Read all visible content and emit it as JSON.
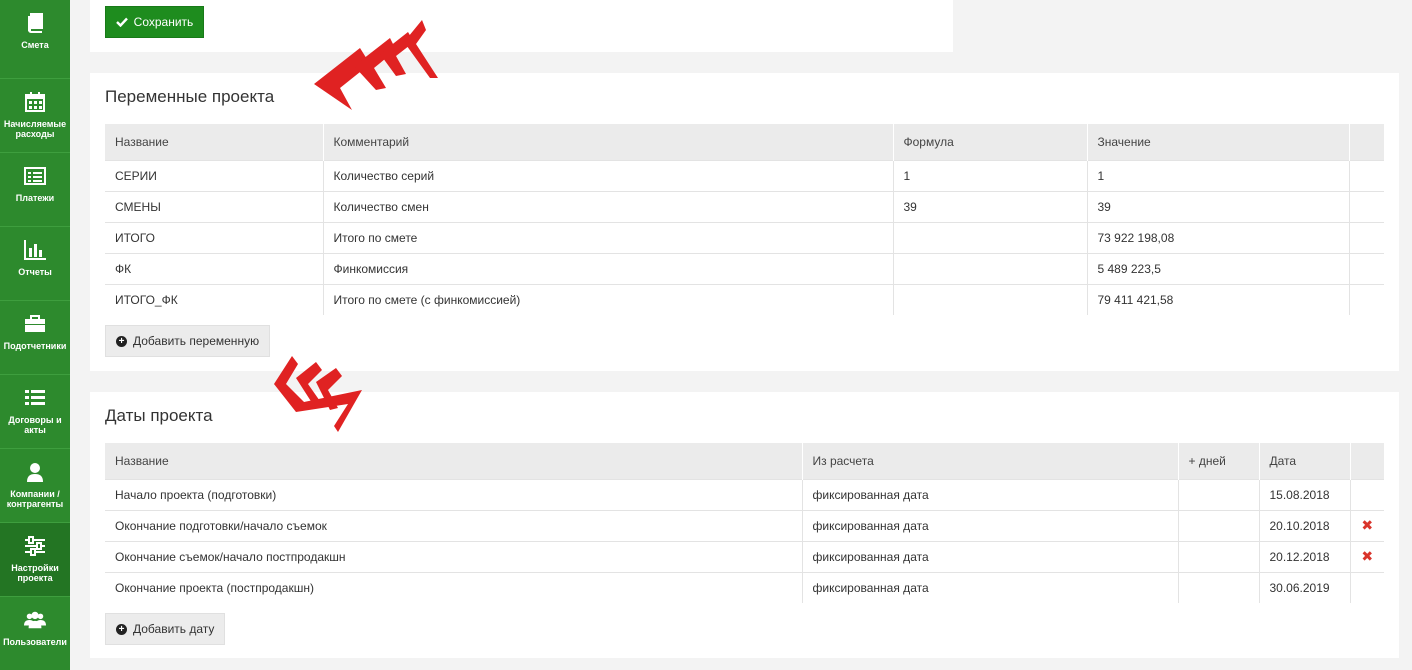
{
  "sidebar": {
    "items": [
      {
        "label": "Смета",
        "icon": "book-icon"
      },
      {
        "label": "Начисляемые расходы",
        "icon": "calendar-icon"
      },
      {
        "label": "Платежи",
        "icon": "list-card-icon"
      },
      {
        "label": "Отчеты",
        "icon": "bar-chart-icon"
      },
      {
        "label": "Подотчетники",
        "icon": "briefcase-icon"
      },
      {
        "label": "Договоры и акты",
        "icon": "list-icon"
      },
      {
        "label": "Компании / контрагенты",
        "icon": "user-icon"
      },
      {
        "label": "Настройки проекта",
        "icon": "sliders-icon"
      },
      {
        "label": "Пользователи",
        "icon": "users-icon"
      }
    ]
  },
  "save_button": {
    "label": "Сохранить"
  },
  "variables": {
    "title": "Переменные проекта",
    "columns": [
      "Название",
      "Комментарий",
      "Формула",
      "Значение"
    ],
    "rows": [
      {
        "name": "СЕРИИ",
        "comment": "Количество серий",
        "formula": "1",
        "value": "1"
      },
      {
        "name": "СМЕНЫ",
        "comment": "Количество смен",
        "formula": "39",
        "value": "39"
      },
      {
        "name": "ИТОГО",
        "comment": "Итого по смете",
        "formula": "",
        "value": "73 922 198,08"
      },
      {
        "name": "ФК",
        "comment": "Финкомиссия",
        "formula": "",
        "value": "5 489 223,5"
      },
      {
        "name": "ИТОГО_ФК",
        "comment": "Итого по смете (с финкомиссией)",
        "formula": "",
        "value": "79 411 421,58"
      }
    ],
    "add_button": "Добавить переменную"
  },
  "dates": {
    "title": "Даты проекта",
    "columns": [
      "Название",
      "Из расчета",
      "+ дней",
      "Дата"
    ],
    "rows": [
      {
        "name": "Начало проекта (подготовки)",
        "basis": "фиксированная дата",
        "days": "",
        "date": "15.08.2018",
        "deletable": false
      },
      {
        "name": "Окончание подготовки/начало съемок",
        "basis": "фиксированная дата",
        "days": "",
        "date": "20.10.2018",
        "deletable": true
      },
      {
        "name": "Окончание съемок/начало постпродакшн",
        "basis": "фиксированная дата",
        "days": "",
        "date": "20.12.2018",
        "deletable": true
      },
      {
        "name": "Окончание проекта (постпродакшн)",
        "basis": "фиксированная дата",
        "days": "",
        "date": "30.06.2019",
        "deletable": false
      }
    ],
    "add_button": "Добавить дату",
    "delete_symbol": "✖"
  },
  "colors": {
    "sidebar": "#2d8a2d",
    "accent_green": "#1e8c1e",
    "arrow_red": "#e02222",
    "delete_red": "#d9342b"
  }
}
